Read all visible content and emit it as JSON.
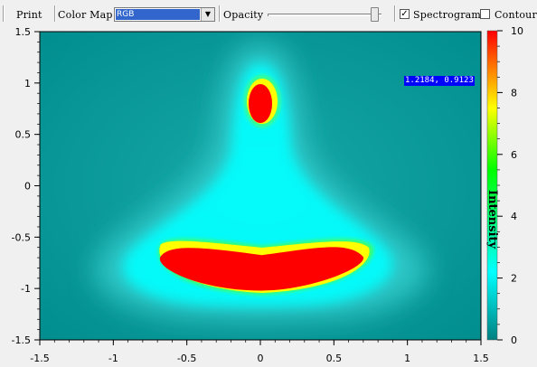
{
  "toolbar": {
    "print_label": "Print",
    "color_map_label": "Color Map",
    "color_map_selected": "RGB",
    "opacity_label": "Opacity",
    "opacity_value": 0.93,
    "spectrogram_label": "Spectrogram",
    "spectrogram_checked": true,
    "contour_label": "Contour",
    "contour_checked": false
  },
  "tooltip": {
    "text": "1.2184, 0.9123"
  },
  "chart_data": {
    "type": "heatmap",
    "xlim": [
      -1.5,
      1.5
    ],
    "ylim": [
      -1.5,
      1.5
    ],
    "x_ticks": [
      "-1.5",
      "-1",
      "-0.5",
      "0",
      "0.5",
      "1",
      "1.5"
    ],
    "y_ticks": [
      "1.5",
      "1",
      "0.5",
      "0",
      "-0.5",
      "-1",
      "-1.5"
    ],
    "colorbar": {
      "label": "Intensity",
      "range": [
        0,
        10
      ],
      "ticks": [
        "10",
        "8",
        "6",
        "4",
        "2",
        "0"
      ],
      "colors": [
        "#008080",
        "#00ffff",
        "#00ff00",
        "#ffff00",
        "#ff0000"
      ]
    },
    "regions": [
      {
        "name": "top blob",
        "center": [
          0.0,
          0.8
        ],
        "extent_x": [
          -0.08,
          0.08
        ],
        "extent_y": [
          0.62,
          1.0
        ]
      },
      {
        "name": "bottom crescent",
        "center": [
          0.0,
          -0.75
        ],
        "extent_x": [
          -0.68,
          0.7
        ],
        "extent_y": [
          -1.02,
          -0.57
        ]
      }
    ]
  }
}
